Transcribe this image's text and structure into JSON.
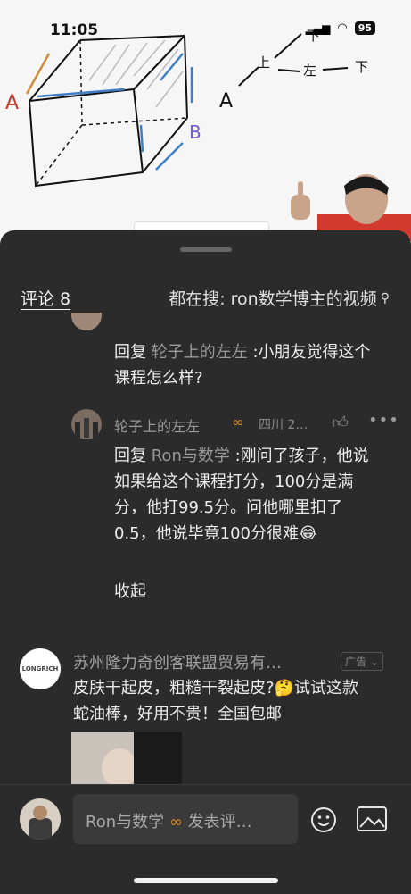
{
  "status_bar": {
    "time": "11:05",
    "battery": "95"
  },
  "video": {
    "whiteboard_labels": {
      "a_left": "A",
      "a_right": "A",
      "b": "B",
      "up_left": "上",
      "left": "左",
      "down1": "下",
      "down2": "下"
    }
  },
  "sheet": {
    "comments_title": "评论 8",
    "search_suggestion": "都在搜: ron数学博主的视频"
  },
  "comments": [
    {
      "reply_prefix": "回复",
      "reply_to": "轮子上的左左",
      "text": ":小朋友觉得这个课程怎么样?"
    },
    {
      "author": "轮子上的左左",
      "location": "四川 2…",
      "reply_prefix": "回复",
      "reply_to": "Ron与数学",
      "text": ":刚问了孩子，他说如果给这个课程打分，100分是满分，他打99.5分。问他哪里扣了0.5，他说毕竟100分很难",
      "emoji": "😂",
      "collapse_label": "收起"
    }
  ],
  "ad": {
    "avatar_text": "LONGRICH",
    "advertiser": "苏州隆力奇创客联盟贸易有…",
    "badge": "广告",
    "text_part1": "皮肤干起皮，粗糙干裂起皮?",
    "emoji": "🤔",
    "text_part2": "试试这款蛇油棒，好用不贵！全国包邮"
  },
  "bottom_bar": {
    "input_placeholder": "Ron与数学 ",
    "input_suffix": " 发表评…"
  },
  "icons": {
    "search": "search-icon",
    "like": "thumb-up-icon",
    "more": "more-icon",
    "emoji": "emoji-icon",
    "image": "image-icon",
    "badge": "infinity-badge-icon"
  },
  "colors": {
    "sheet_bg": "#2b2b2b",
    "accent_orange": "#d48b2a"
  }
}
